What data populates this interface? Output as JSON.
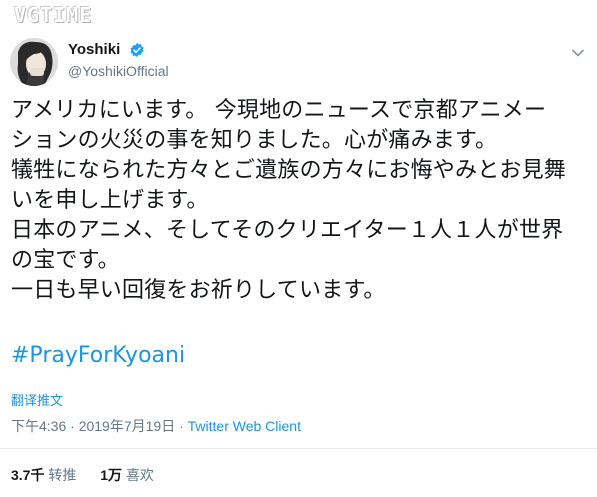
{
  "watermark": "VGTIME",
  "user": {
    "display_name": "Yoshiki",
    "handle": "@YoshikiOfficial",
    "verified_icon": "verified-badge-icon",
    "accent_color": "#1da1f2"
  },
  "tweet": {
    "lines": [
      "アメリカにいます。 今現地のニュースで京都アニメー",
      "ションの火災の事を知りました。心が痛みます。",
      "犠牲になられた方々とご遺族の方々にお悔やみとお見舞",
      "いを申し上げます。",
      "日本のアニメ、そしてそのクリエイター１人１人が世界",
      "の宝です。",
      "一日も早い回復をお祈りしています。"
    ],
    "hashtag": "#PrayForKyoani",
    "translate_label": "翻译推文",
    "time": "下午4:36 · 2019年7月19日 · ",
    "client": "Twitter Web Client"
  },
  "stats": {
    "retweets_count": "3.7千",
    "retweets_label": "转推",
    "likes_count": "1万",
    "likes_label": "喜欢"
  },
  "colors": {
    "link": "#1b95e0",
    "muted": "#657786",
    "text": "#14171a"
  }
}
